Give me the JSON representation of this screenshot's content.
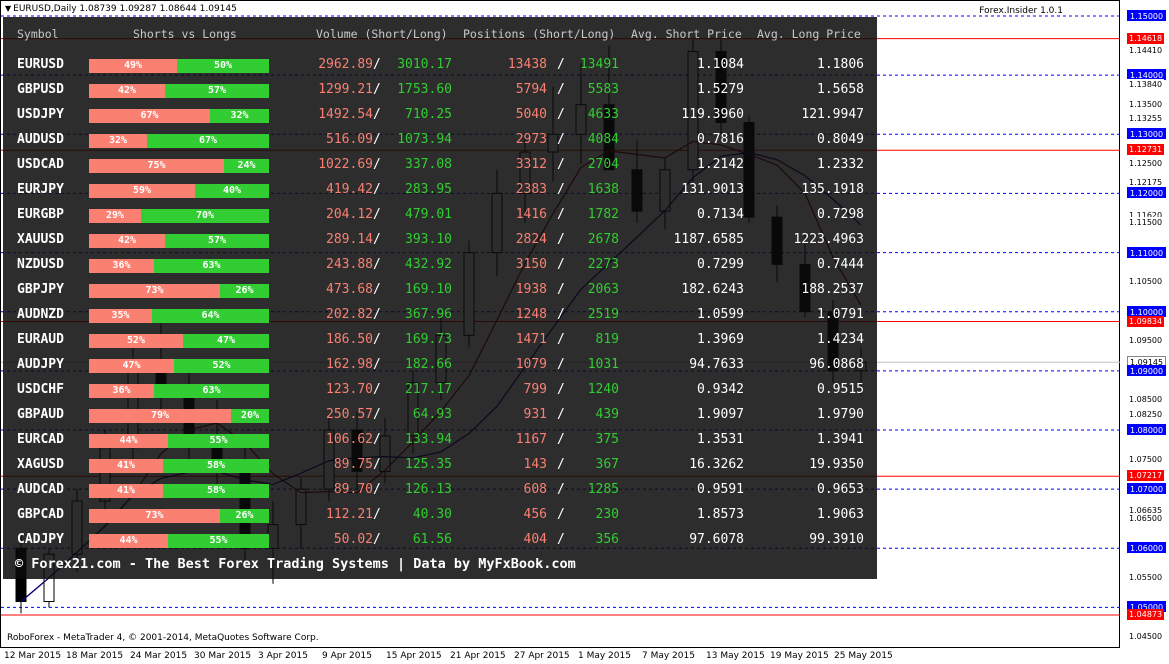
{
  "window": {
    "title": "EURUSD,Daily  1.08739 1.09287 1.08644 1.09145",
    "indicator": "Forex.Insider 1.0.1",
    "copyright": "RoboForex - MetaTrader 4, © 2001-2014, MetaQuotes Software Corp."
  },
  "price_axis": [
    {
      "text": "1.15000",
      "style": "blue"
    },
    {
      "text": "1.14618",
      "style": "red"
    },
    {
      "text": "1.14410",
      "style": "plain"
    },
    {
      "text": "1.14000",
      "style": "blue"
    },
    {
      "text": "1.13840",
      "style": "plain"
    },
    {
      "text": "1.13500",
      "style": "plain"
    },
    {
      "text": "1.13255",
      "style": "plain"
    },
    {
      "text": "1.13000",
      "style": "blue"
    },
    {
      "text": "1.12731",
      "style": "red"
    },
    {
      "text": "1.12500",
      "style": "plain"
    },
    {
      "text": "1.12175",
      "style": "plain"
    },
    {
      "text": "1.12000",
      "style": "blue"
    },
    {
      "text": "1.11620",
      "style": "plain"
    },
    {
      "text": "1.11500",
      "style": "plain"
    },
    {
      "text": "1.11000",
      "style": "blue"
    },
    {
      "text": "1.10500",
      "style": "plain"
    },
    {
      "text": "1.10000",
      "style": "blue"
    },
    {
      "text": "1.09834",
      "style": "red"
    },
    {
      "text": "1.09500",
      "style": "plain"
    },
    {
      "text": "1.09145",
      "style": "current"
    },
    {
      "text": "1.09000",
      "style": "blue"
    },
    {
      "text": "1.08500",
      "style": "plain"
    },
    {
      "text": "1.08250",
      "style": "plain"
    },
    {
      "text": "1.08000",
      "style": "blue"
    },
    {
      "text": "1.07500",
      "style": "plain"
    },
    {
      "text": "1.07217",
      "style": "red"
    },
    {
      "text": "1.07000",
      "style": "blue"
    },
    {
      "text": "1.06635",
      "style": "plain"
    },
    {
      "text": "1.06500",
      "style": "plain"
    },
    {
      "text": "1.06000",
      "style": "blue"
    },
    {
      "text": "1.05500",
      "style": "plain"
    },
    {
      "text": "1.05000",
      "style": "blue"
    },
    {
      "text": "1.04873",
      "style": "red"
    },
    {
      "text": "1.04500",
      "style": "plain"
    }
  ],
  "time_axis": [
    "12 Mar 2015",
    "18 Mar 2015",
    "24 Mar 2015",
    "30 Mar 2015",
    "3 Apr 2015",
    "9 Apr 2015",
    "15 Apr 2015",
    "21 Apr 2015",
    "27 Apr 2015",
    "1 May 2015",
    "7 May 2015",
    "13 May 2015",
    "19 May 2015",
    "25 May 2015"
  ],
  "table": {
    "headers": {
      "symbol": "Symbol",
      "ratio": "Shorts vs Longs",
      "volume": "Volume (Short/Long)",
      "positions": "Positions (Short/Long)",
      "avg_short": "Avg. Short Price",
      "avg_long": "Avg. Long Price"
    },
    "rows": [
      {
        "symbol": "EURUSD",
        "short_pct": "49%",
        "long_pct": "50%",
        "short_frac": 0.49,
        "vol_short": "2962.89",
        "vol_long": "3010.17",
        "pos_short": "13438",
        "pos_long": "13491",
        "avg_short": "1.1084",
        "avg_long": "1.1806"
      },
      {
        "symbol": "GBPUSD",
        "short_pct": "42%",
        "long_pct": "57%",
        "short_frac": 0.42,
        "vol_short": "1299.21",
        "vol_long": "1753.60",
        "pos_short": "5794",
        "pos_long": "5583",
        "avg_short": "1.5279",
        "avg_long": "1.5658"
      },
      {
        "symbol": "USDJPY",
        "short_pct": "67%",
        "long_pct": "32%",
        "short_frac": 0.67,
        "vol_short": "1492.54",
        "vol_long": "710.25",
        "pos_short": "5040",
        "pos_long": "4633",
        "avg_short": "119.3960",
        "avg_long": "121.9947"
      },
      {
        "symbol": "AUDUSD",
        "short_pct": "32%",
        "long_pct": "67%",
        "short_frac": 0.32,
        "vol_short": "516.09",
        "vol_long": "1073.94",
        "pos_short": "2973",
        "pos_long": "4084",
        "avg_short": "0.7816",
        "avg_long": "0.8049"
      },
      {
        "symbol": "USDCAD",
        "short_pct": "75%",
        "long_pct": "24%",
        "short_frac": 0.75,
        "vol_short": "1022.69",
        "vol_long": "337.08",
        "pos_short": "3312",
        "pos_long": "2704",
        "avg_short": "1.2142",
        "avg_long": "1.2332"
      },
      {
        "symbol": "EURJPY",
        "short_pct": "59%",
        "long_pct": "40%",
        "short_frac": 0.59,
        "vol_short": "419.42",
        "vol_long": "283.95",
        "pos_short": "2383",
        "pos_long": "1638",
        "avg_short": "131.9013",
        "avg_long": "135.1918"
      },
      {
        "symbol": "EURGBP",
        "short_pct": "29%",
        "long_pct": "70%",
        "short_frac": 0.29,
        "vol_short": "204.12",
        "vol_long": "479.01",
        "pos_short": "1416",
        "pos_long": "1782",
        "avg_short": "0.7134",
        "avg_long": "0.7298"
      },
      {
        "symbol": "XAUUSD",
        "short_pct": "42%",
        "long_pct": "57%",
        "short_frac": 0.42,
        "vol_short": "289.14",
        "vol_long": "393.10",
        "pos_short": "2824",
        "pos_long": "2678",
        "avg_short": "1187.6585",
        "avg_long": "1223.4963"
      },
      {
        "symbol": "NZDUSD",
        "short_pct": "36%",
        "long_pct": "63%",
        "short_frac": 0.36,
        "vol_short": "243.88",
        "vol_long": "432.92",
        "pos_short": "3150",
        "pos_long": "2273",
        "avg_short": "0.7299",
        "avg_long": "0.7444"
      },
      {
        "symbol": "GBPJPY",
        "short_pct": "73%",
        "long_pct": "26%",
        "short_frac": 0.73,
        "vol_short": "473.68",
        "vol_long": "169.10",
        "pos_short": "1938",
        "pos_long": "2063",
        "avg_short": "182.6243",
        "avg_long": "188.2537"
      },
      {
        "symbol": "AUDNZD",
        "short_pct": "35%",
        "long_pct": "64%",
        "short_frac": 0.35,
        "vol_short": "202.82",
        "vol_long": "367.96",
        "pos_short": "1248",
        "pos_long": "2519",
        "avg_short": "1.0599",
        "avg_long": "1.0791"
      },
      {
        "symbol": "EURAUD",
        "short_pct": "52%",
        "long_pct": "47%",
        "short_frac": 0.52,
        "vol_short": "186.50",
        "vol_long": "169.73",
        "pos_short": "1471",
        "pos_long": "819",
        "avg_short": "1.3969",
        "avg_long": "1.4234"
      },
      {
        "symbol": "AUDJPY",
        "short_pct": "47%",
        "long_pct": "52%",
        "short_frac": 0.47,
        "vol_short": "162.98",
        "vol_long": "182.66",
        "pos_short": "1079",
        "pos_long": "1031",
        "avg_short": "94.7633",
        "avg_long": "96.0868"
      },
      {
        "symbol": "USDCHF",
        "short_pct": "36%",
        "long_pct": "63%",
        "short_frac": 0.36,
        "vol_short": "123.70",
        "vol_long": "217.17",
        "pos_short": "799",
        "pos_long": "1240",
        "avg_short": "0.9342",
        "avg_long": "0.9515"
      },
      {
        "symbol": "GBPAUD",
        "short_pct": "79%",
        "long_pct": "20%",
        "short_frac": 0.79,
        "vol_short": "250.57",
        "vol_long": "64.93",
        "pos_short": "931",
        "pos_long": "439",
        "avg_short": "1.9097",
        "avg_long": "1.9790"
      },
      {
        "symbol": "EURCAD",
        "short_pct": "44%",
        "long_pct": "55%",
        "short_frac": 0.44,
        "vol_short": "106.62",
        "vol_long": "133.94",
        "pos_short": "1167",
        "pos_long": "375",
        "avg_short": "1.3531",
        "avg_long": "1.3941"
      },
      {
        "symbol": "XAGUSD",
        "short_pct": "41%",
        "long_pct": "58%",
        "short_frac": 0.41,
        "vol_short": "89.75",
        "vol_long": "125.35",
        "pos_short": "143",
        "pos_long": "367",
        "avg_short": "16.3262",
        "avg_long": "19.9350"
      },
      {
        "symbol": "AUDCAD",
        "short_pct": "41%",
        "long_pct": "58%",
        "short_frac": 0.41,
        "vol_short": "89.70",
        "vol_long": "126.13",
        "pos_short": "608",
        "pos_long": "1285",
        "avg_short": "0.9591",
        "avg_long": "0.9653"
      },
      {
        "symbol": "GBPCAD",
        "short_pct": "73%",
        "long_pct": "26%",
        "short_frac": 0.73,
        "vol_short": "112.21",
        "vol_long": "40.30",
        "pos_short": "456",
        "pos_long": "230",
        "avg_short": "1.8573",
        "avg_long": "1.9063"
      },
      {
        "symbol": "CADJPY",
        "short_pct": "44%",
        "long_pct": "55%",
        "short_frac": 0.44,
        "vol_short": "50.02",
        "vol_long": "61.56",
        "pos_short": "404",
        "pos_long": "356",
        "avg_short": "97.6078",
        "avg_long": "99.3910"
      }
    ],
    "footer": "© Forex21.com - The Best Forex Trading Systems | Data by MyFxBook.com"
  },
  "colors": {
    "short": "#fa8072",
    "long": "#32cd32",
    "panel_bg": "#0a0a0a",
    "support_line": "#0000ff",
    "resistance_line": "#ff0000"
  }
}
